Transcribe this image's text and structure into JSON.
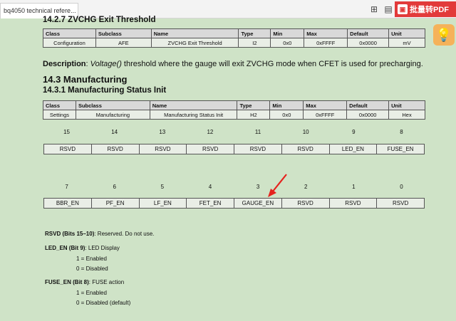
{
  "browser": {
    "tab_title": "bq4050 technical refere...",
    "pdf_button": "批量转PDF"
  },
  "section_zv": {
    "heading": "14.2.7 ZVCHG Exit Threshold",
    "headers": [
      "Class",
      "Subclass",
      "Name",
      "Type",
      "Min",
      "Max",
      "Default",
      "Unit"
    ],
    "row": [
      "Configuration",
      "AFE",
      "ZVCHG Exit Threshold",
      "I2",
      "0x0",
      "0xFFFF",
      "0x0000",
      "mV"
    ],
    "desc_label": "Description",
    "desc_italic": "Voltage()",
    "desc_text": " threshold where the gauge will exit ZVCHG mode when CFET is used for precharging."
  },
  "section_manu": {
    "heading": "14.3 Manufacturing",
    "sub_heading": "14.3.1 Manufacturing Status Init",
    "headers": [
      "Class",
      "Subclass",
      "Name",
      "Type",
      "Min",
      "Max",
      "Default",
      "Unit"
    ],
    "row": [
      "Settings",
      "Manufacturing",
      "Manufacturing Status Init",
      "H2",
      "0x0",
      "0xFFFF",
      "0x0000",
      "Hex"
    ]
  },
  "bits_high": {
    "numbers": [
      "15",
      "14",
      "13",
      "12",
      "11",
      "10",
      "9",
      "8"
    ],
    "names": [
      "RSVD",
      "RSVD",
      "RSVD",
      "RSVD",
      "RSVD",
      "RSVD",
      "LED_EN",
      "FUSE_EN"
    ]
  },
  "bits_low": {
    "numbers": [
      "7",
      "6",
      "5",
      "4",
      "3",
      "2",
      "1",
      "0"
    ],
    "names": [
      "BBR_EN",
      "PF_EN",
      "LF_EN",
      "FET_EN",
      "GAUGE_EN",
      "RSVD",
      "RSVD",
      "RSVD"
    ]
  },
  "notes": {
    "rsvd_label": "RSVD (Bits 15–10)",
    "rsvd_text": ": Reserved. Do not use.",
    "led_label": "LED_EN (Bit 9)",
    "led_text": ": LED Display",
    "led_1": "1 =  Enabled",
    "led_0": "0 =  Disabled",
    "fuse_label": "FUSE_EN (Bit 8)",
    "fuse_text": ": FUSE action",
    "fuse_1": "1 =  Enabled",
    "fuse_0": "0 =  Disabled (default)"
  },
  "colors": {
    "page_bg": "#cfe3c7",
    "arrow": "#e5231e",
    "pdf_button": "#e23a3a"
  }
}
